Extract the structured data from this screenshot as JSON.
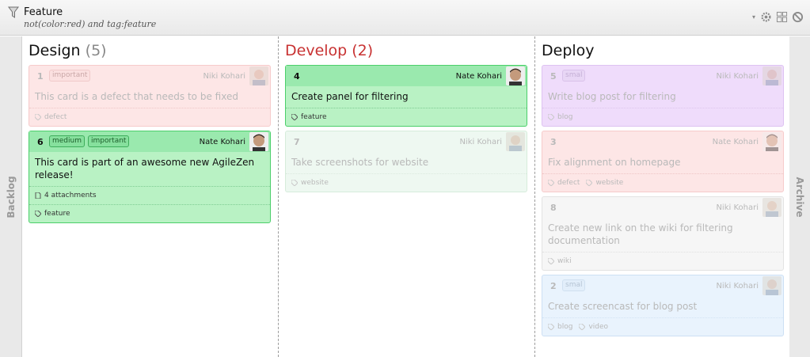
{
  "filter": {
    "title": "Feature",
    "query": "not(color:red) and tag:feature"
  },
  "rails": {
    "left": "Backlog",
    "right": "Archive"
  },
  "columns": [
    {
      "name": "Design",
      "count": "(5)",
      "cards": [
        {
          "id": "1",
          "tags": [
            "important"
          ],
          "owner": "Niki Kohari",
          "text": "This card is a defect that needs to be fixed",
          "meta": [
            "defect"
          ]
        },
        {
          "id": "6",
          "tags": [
            "medium",
            "important"
          ],
          "owner": "Nate Kohari",
          "text": "This card is part of an awesome new AgileZen release!",
          "attachments": "4 attachments",
          "meta": [
            "feature"
          ]
        }
      ]
    },
    {
      "name": "Develop",
      "count": "(2)",
      "cards": [
        {
          "id": "4",
          "owner": "Nate Kohari",
          "text": "Create panel for filtering",
          "meta": [
            "feature"
          ]
        },
        {
          "id": "7",
          "owner": "Niki Kohari",
          "text": "Take screenshots for website",
          "meta": [
            "website"
          ]
        }
      ]
    },
    {
      "name": "Deploy",
      "cards": [
        {
          "id": "5",
          "tags": [
            "smal"
          ],
          "owner": "Niki Kohari",
          "text": "Write blog post for filtering",
          "meta": [
            "blog"
          ]
        },
        {
          "id": "3",
          "owner": "Nate Kohari",
          "text": "Fix alignment on homepage",
          "meta": [
            "defect",
            "website"
          ]
        },
        {
          "id": "8",
          "owner": "Niki Kohari",
          "text": "Create new link on the wiki for filtering documentation",
          "meta": [
            "wiki"
          ]
        },
        {
          "id": "2",
          "tags": [
            "smal"
          ],
          "owner": "Niki Kohari",
          "text": "Create screencast for blog post",
          "meta": [
            "blog",
            "video"
          ]
        }
      ]
    }
  ]
}
